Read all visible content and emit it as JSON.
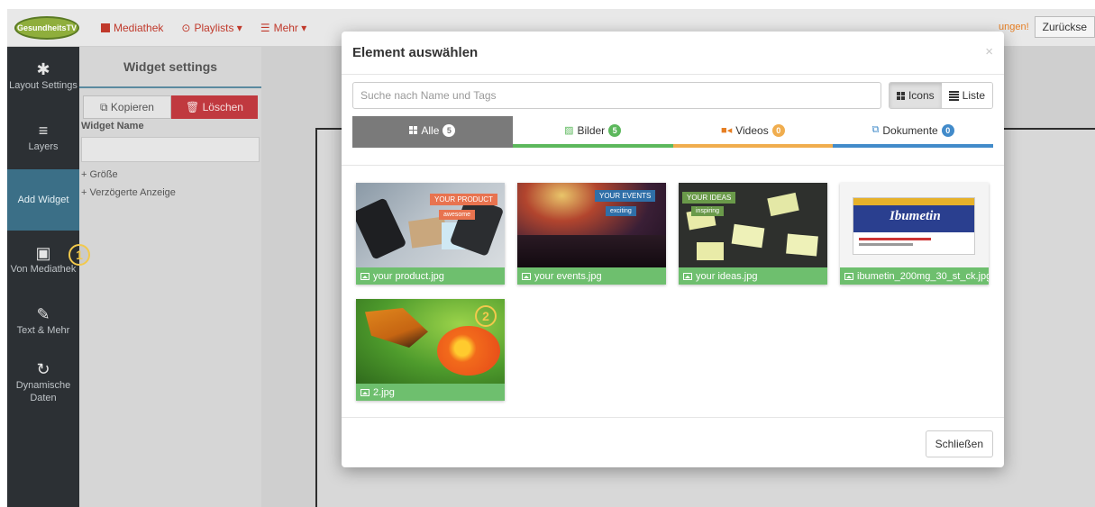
{
  "topbar": {
    "logo_text": "GesundheitsTV",
    "nav": [
      {
        "label": "Mediathek"
      },
      {
        "label": "Playlists ▾"
      },
      {
        "label": "Mehr ▾"
      }
    ],
    "warning_text": "ungen!",
    "back_label": "Zurückse"
  },
  "leftnav": {
    "items": [
      {
        "label": "Layout Settings",
        "icon": "puzzle-icon"
      },
      {
        "label": "Layers",
        "icon": "list-icon"
      },
      {
        "label": "Add Widget",
        "icon": "none"
      },
      {
        "label": "Von Mediathek",
        "icon": "media-icon"
      },
      {
        "label": "Text & Mehr",
        "icon": "pencil-icon"
      },
      {
        "label": "Dynamische Daten",
        "icon": "refresh-icon"
      }
    ]
  },
  "panel": {
    "title": "Widget settings",
    "copy_label": "Kopieren",
    "delete_label": "Löschen",
    "name_label": "Widget Name",
    "size_label": "+ Größe",
    "delay_label": "+ Verzögerte Anzeige"
  },
  "markers": {
    "one": "1",
    "two": "2"
  },
  "modal": {
    "title": "Element auswählen",
    "close_x": "×",
    "search_placeholder": "Suche nach Name und Tags",
    "view_icons": "Icons",
    "view_list": "Liste",
    "tabs": [
      {
        "label": "Alle",
        "count": "5"
      },
      {
        "label": "Bilder",
        "count": "5"
      },
      {
        "label": "Videos",
        "count": "0"
      },
      {
        "label": "Dokumente",
        "count": "0"
      }
    ],
    "items": [
      {
        "name": "your product.jpg",
        "tag1": "YOUR PRODUCT",
        "tag2": "awesome"
      },
      {
        "name": "your events.jpg",
        "tag1": "YOUR EVENTS",
        "tag2": "exciting"
      },
      {
        "name": "your ideas.jpg",
        "tag1": "YOUR IDEAS",
        "tag2": "inspiring"
      },
      {
        "name": "ibumetin_200mg_30_st_ck.jpg",
        "brand": "Ibumetin"
      },
      {
        "name": "2.jpg"
      }
    ],
    "close_button": "Schließen"
  },
  "colors": {
    "accent_red": "#c0392b",
    "tab_green": "#5cb85c",
    "tab_orange": "#f0ad4e",
    "tab_blue": "#428bca",
    "caption_green": "#6ebf6e",
    "nav_active": "#3b6f87"
  }
}
